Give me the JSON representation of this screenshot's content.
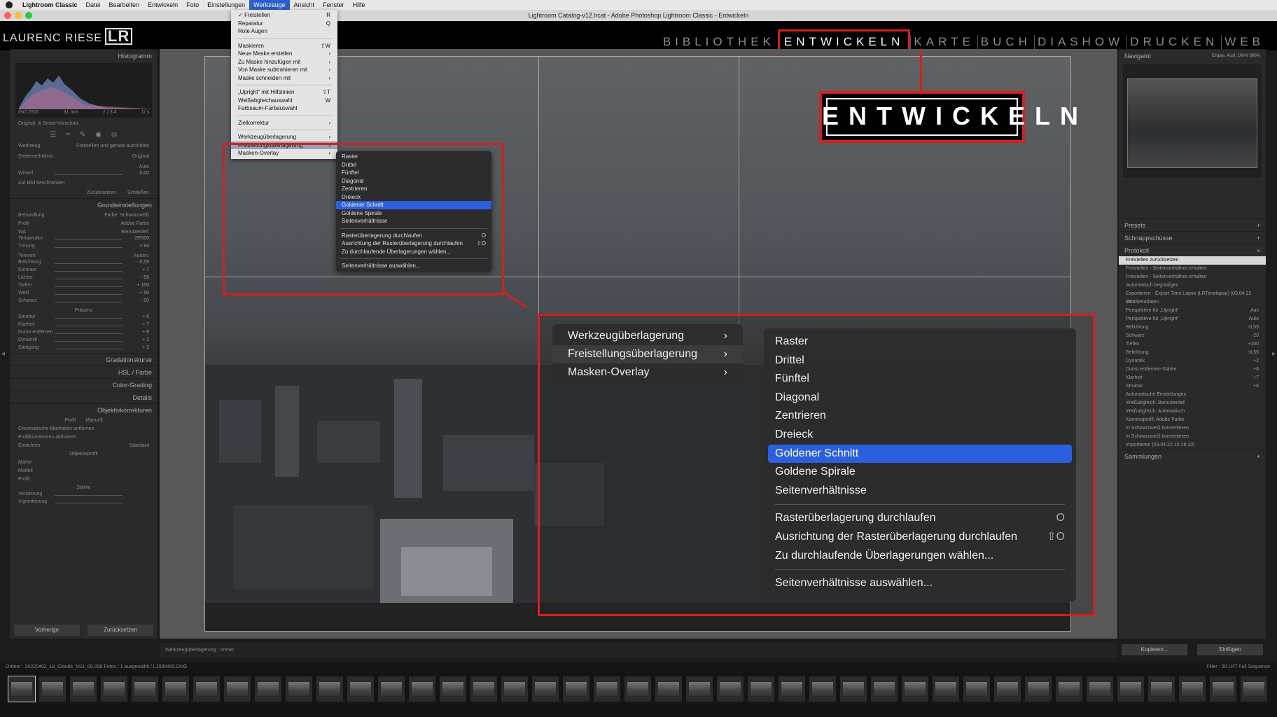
{
  "menubar": {
    "app": "Lightroom Classic",
    "items": [
      "Datei",
      "Bearbeiten",
      "Entwickeln",
      "Foto",
      "Einstellungen",
      "Werkzeuge",
      "Ansicht",
      "Fenster",
      "Hilfe"
    ]
  },
  "window_title": "Lightroom Catalog-v12.lrcat - Adobe Photoshop Lightroom Classic - Entwickeln",
  "identity_plate": "LAURENC RIESE",
  "identity_plate_mark": "LR",
  "modules": [
    "BIBLIOTHEK",
    "ENTWICKELN",
    "KARTE",
    "BUCH",
    "DIASHOW",
    "DRUCKEN",
    "WEB"
  ],
  "active_module": "ENTWICKELN",
  "badge_text": "ENTWICKELN",
  "werkzeuge_menu": [
    {
      "label": "Freistellen",
      "checked": true,
      "shortcut": "R"
    },
    {
      "label": "Reparatur",
      "shortcut": "Q"
    },
    {
      "label": "Rote Augen",
      "shortcut": ""
    },
    {
      "sep": true
    },
    {
      "label": "Maskieren",
      "shortcut": "⇧W"
    },
    {
      "label": "Neue Maske erstellen",
      "sub": true
    },
    {
      "label": "Zu Maske hinzufügen mit",
      "sub": true
    },
    {
      "label": "Von Maske subtrahieren mit",
      "sub": true
    },
    {
      "label": "Maske schneiden mit",
      "sub": true
    },
    {
      "sep": true
    },
    {
      "label": "„Upright“ mit Hilfslinien",
      "shortcut": "⇧T"
    },
    {
      "label": "Weißabgleichauswahl",
      "shortcut": "W"
    },
    {
      "label": "Farbsaum-Farbauswahl",
      "shortcut": ""
    },
    {
      "sep": true
    },
    {
      "label": "Zielkorrektur",
      "sub": true
    },
    {
      "sep": true
    },
    {
      "label": "Werkzeugüberlagerung",
      "sub": true
    },
    {
      "label": "Freistellungsüberlagerung",
      "sub": true,
      "highlight": true
    },
    {
      "label": "Masken-Overlay",
      "sub": true
    }
  ],
  "overlay_submenu_small": [
    {
      "label": "Raster"
    },
    {
      "label": "Drittel"
    },
    {
      "label": "Fünftel"
    },
    {
      "label": "Diagonal"
    },
    {
      "label": "Zentrieren"
    },
    {
      "label": "Dreieck"
    },
    {
      "label": "Goldener Schnitt",
      "highlight": true
    },
    {
      "label": "Goldene Spirale"
    },
    {
      "label": "Seitenverhältnisse"
    },
    {
      "sep": true
    },
    {
      "label": "Rasterüberlagerung durchlaufen",
      "shortcut": "O"
    },
    {
      "label": "Ausrichtung der Rasterüberlagerung durchlaufen",
      "shortcut": "⇧O"
    },
    {
      "label": "Zu durchlaufende Überlagerungen wählen...",
      "shortcut": ""
    },
    {
      "sep": true
    },
    {
      "label": "Seitenverhältnisse auswählen...",
      "shortcut": ""
    }
  ],
  "zoom_left": [
    {
      "label": "Werkzeugüberlagerung"
    },
    {
      "label": "Freistellungsüberlagerung",
      "highlight": true
    },
    {
      "label": "Masken-Overlay"
    }
  ],
  "zoom_right": [
    {
      "label": "Raster"
    },
    {
      "label": "Drittel"
    },
    {
      "label": "Fünftel"
    },
    {
      "label": "Diagonal"
    },
    {
      "label": "Zentrieren"
    },
    {
      "label": "Dreieck"
    },
    {
      "label": "Goldener Schnitt",
      "highlight": true
    },
    {
      "label": "Goldene Spirale"
    },
    {
      "label": "Seitenverhältnisse"
    },
    {
      "sep": true
    },
    {
      "label": "Rasterüberlagerung durchlaufen",
      "shortcut": "O"
    },
    {
      "label": "Ausrichtung der Rasterüberlagerung durchlaufen",
      "shortcut": "⇧O"
    },
    {
      "label": "Zu durchlaufende Überlagerungen wählen...",
      "shortcut": ""
    },
    {
      "sep": true
    },
    {
      "label": "Seitenverhältnisse auswählen...",
      "shortcut": ""
    }
  ],
  "left_panel": {
    "histogram": "Histogramm",
    "hist_info": [
      "ISO 2500",
      "31 mm",
      "ƒ / 3,4",
      "1/ s"
    ],
    "preview_label": "Original- & Smart-Vorschau",
    "tool_label": "Werkzeug",
    "tool_value": "Freistellen und gerade ausrichten",
    "aspect_label": "Seitenverhältnis",
    "aspect_value": "Original",
    "auto": "Auto",
    "angle_label": "Winkel",
    "angle_value": "0,00",
    "constrain": "Auf Bild beschränken",
    "reset": "Zurücksetzen",
    "close": "Schließen",
    "basic": "Grundeinstellungen",
    "treatment": "Behandlung",
    "color": "Farbe",
    "bw": "Schwarzweiß",
    "profile_label": "Profil",
    "profile_value": "Adobe Farbe",
    "wb": "WA",
    "wb_value": "Benutzerdef.",
    "sliders_wb": [
      {
        "label": "Temperatur",
        "value": "29'000"
      },
      {
        "label": "Tönung",
        "value": "+ 83"
      }
    ],
    "tone": "Tonwert",
    "tone_auto": "Autom.",
    "sliders_tone": [
      {
        "label": "Belichtung",
        "value": "- 0,55"
      },
      {
        "label": "Kontrast",
        "value": "+ 7"
      },
      {
        "label": "Lichter",
        "value": "- 59"
      },
      {
        "label": "Tiefen",
        "value": "+ 100"
      },
      {
        "label": "Weiß",
        "value": "+ 50"
      },
      {
        "label": "Schwarz",
        "value": "- 20"
      }
    ],
    "presence": "Präsenz",
    "sliders_presence": [
      {
        "label": "Struktur",
        "value": "+ 6"
      },
      {
        "label": "Klarheit",
        "value": "+ 7"
      },
      {
        "label": "Dunst entfernen",
        "value": "+ 6"
      },
      {
        "label": "Dynamik",
        "value": "+ 2"
      },
      {
        "label": "Sättigung",
        "value": "+ 2"
      }
    ],
    "sections": [
      "Gradationskurve",
      "HSL / Farbe",
      "Color-Grading",
      "Details",
      "Objektivkorrekturen"
    ],
    "lens_tabs": [
      "Profil",
      "Manuell"
    ],
    "lens_options": [
      "Chromatische Aberration entfernen",
      "Profilkorrekturen aktivieren"
    ],
    "setup_label": "Einrichten",
    "setup_value": "Standard",
    "lens_profile": "Objektivprofil",
    "make": "Marke",
    "model": "Modell",
    "profile": "Profil",
    "amount": "Stärke",
    "distortion": "Verzerrung",
    "vignetting": "Vignettierung",
    "prev": "Vorherige",
    "reset_all": "Zurücksetzen"
  },
  "right_panel": {
    "navigator": "Navigator",
    "nav_zoom": [
      "Einpas.",
      "Ausf.",
      "100%",
      "300%"
    ],
    "presets": "Presets",
    "snapshots": "Schnappschüsse",
    "history": "Protokoll",
    "history_items": [
      {
        "label": "Freistellen zurücksetzen",
        "value": "",
        "selected": true
      },
      {
        "label": "Freistellen - Seitenverhältnis erhalten",
        "value": ""
      },
      {
        "label": "Freistellen - Seitenverhältnis erhalten",
        "value": ""
      },
      {
        "label": "Automatisch begradigen",
        "value": ""
      },
      {
        "label": "Exportieren - Export Time Lapse (LRTimelapse) (03.04.22 19:3...",
        "value": ""
      },
      {
        "label": "Von Metadaten",
        "value": ""
      },
      {
        "label": "Perspektive für „Upright“",
        "value": "Aus"
      },
      {
        "label": "Perspektive für „Upright“",
        "value": "Auto"
      },
      {
        "label": "Belichtung",
        "value": "-0,55"
      },
      {
        "label": "Schwarz",
        "value": "-20"
      },
      {
        "label": "Tiefen",
        "value": "+100"
      },
      {
        "label": "Belichtung",
        "value": "-0,55"
      },
      {
        "label": "Dynamik",
        "value": "+2"
      },
      {
        "label": "Dunst entfernen-Stärke",
        "value": "+6"
      },
      {
        "label": "Klarheit",
        "value": "+7"
      },
      {
        "label": "Struktur",
        "value": "+6"
      },
      {
        "label": "Automatische Einstellungen",
        "value": ""
      },
      {
        "label": "Weißabgleich: Benutzerdef.",
        "value": ""
      },
      {
        "label": "Weißabgleich: Automatisch",
        "value": ""
      },
      {
        "label": "Kameraprofil: Adobe Farbe",
        "value": ""
      },
      {
        "label": "In Schwarzweiß konvertieren",
        "value": ""
      },
      {
        "label": "In Schwarzweiß konvertieren",
        "value": ""
      },
      {
        "label": "Importieren (03.04.22 15:18:10)",
        "value": ""
      }
    ],
    "collections": "Sammlungen",
    "copy": "Kopieren...",
    "paste": "Einfügen"
  },
  "toolbar": {
    "label": "Werkzeugüberlagerung :",
    "value": "Immer"
  },
  "filmstrip": {
    "info": "Ordner : 20220402_18_Clouds_M11_00   299 Fotos / 1 ausgewählt / L1000405.DNG",
    "filter_label": "Filter :",
    "filter_value": "00 LRT Full Sequence"
  },
  "colors": {
    "accent_red": "#d32020",
    "menu_highlight": "#2b5fe0"
  }
}
